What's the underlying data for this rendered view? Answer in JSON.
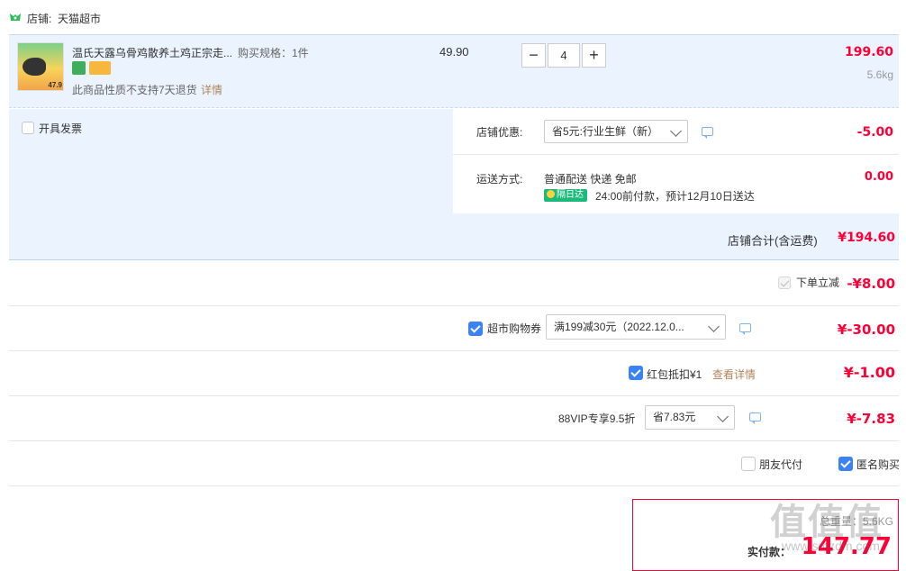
{
  "shop": {
    "label": "店铺:",
    "name": "天猫超市"
  },
  "item": {
    "title": "温氏天露乌骨鸡散养土鸡正宗走...",
    "spec": "购买规格：1件",
    "unit_price": "49.90",
    "quantity": "4",
    "total": "199.60",
    "weight": "5.6kg",
    "notice": "此商品性质不支持7天退货",
    "detail_link": "详情",
    "thumb_price": "47.9"
  },
  "invoice": {
    "label": "开具发票"
  },
  "shop_discount": {
    "label": "店铺优惠:",
    "selected": "省5元:行业生鲜（新）",
    "amount": "-5.00"
  },
  "shipping": {
    "label": "运送方式:",
    "method": "普通配送 快递 免邮",
    "badge": "隔日达",
    "eta": "24:00前付款，预计12月10日送达",
    "fee": "0.00"
  },
  "shop_total": {
    "label": "店铺合计(含运费)",
    "value": "¥194.60"
  },
  "order_discount": {
    "label": "下单立减",
    "value": "-¥8.00"
  },
  "coupon": {
    "label": "超市购物券",
    "selected": "满199减30元（2022.12.0...",
    "value": "¥-30.00"
  },
  "redpacket": {
    "label": "红包抵扣¥1",
    "link": "查看详情",
    "value": "¥-1.00"
  },
  "vip": {
    "label": "88VIP专享9.5折",
    "selected": "省7.83元",
    "value": "¥-7.83"
  },
  "options": {
    "friend_pay": "朋友代付",
    "anonymous": "匿名购买"
  },
  "summary": {
    "weight_text": "总重量：5.6KG",
    "pay_label": "实付款：",
    "pay_value": "147.77",
    "watermark": "值 什么值得买",
    "watermark_url": "www.smzdm.com"
  },
  "colors": {
    "accent_red": "#ff0036",
    "highlight_bg": "#eaf3fe",
    "checkbox_blue": "#3b82f6",
    "link_brown": "#b0855c",
    "badge_green": "#1bb97a"
  }
}
